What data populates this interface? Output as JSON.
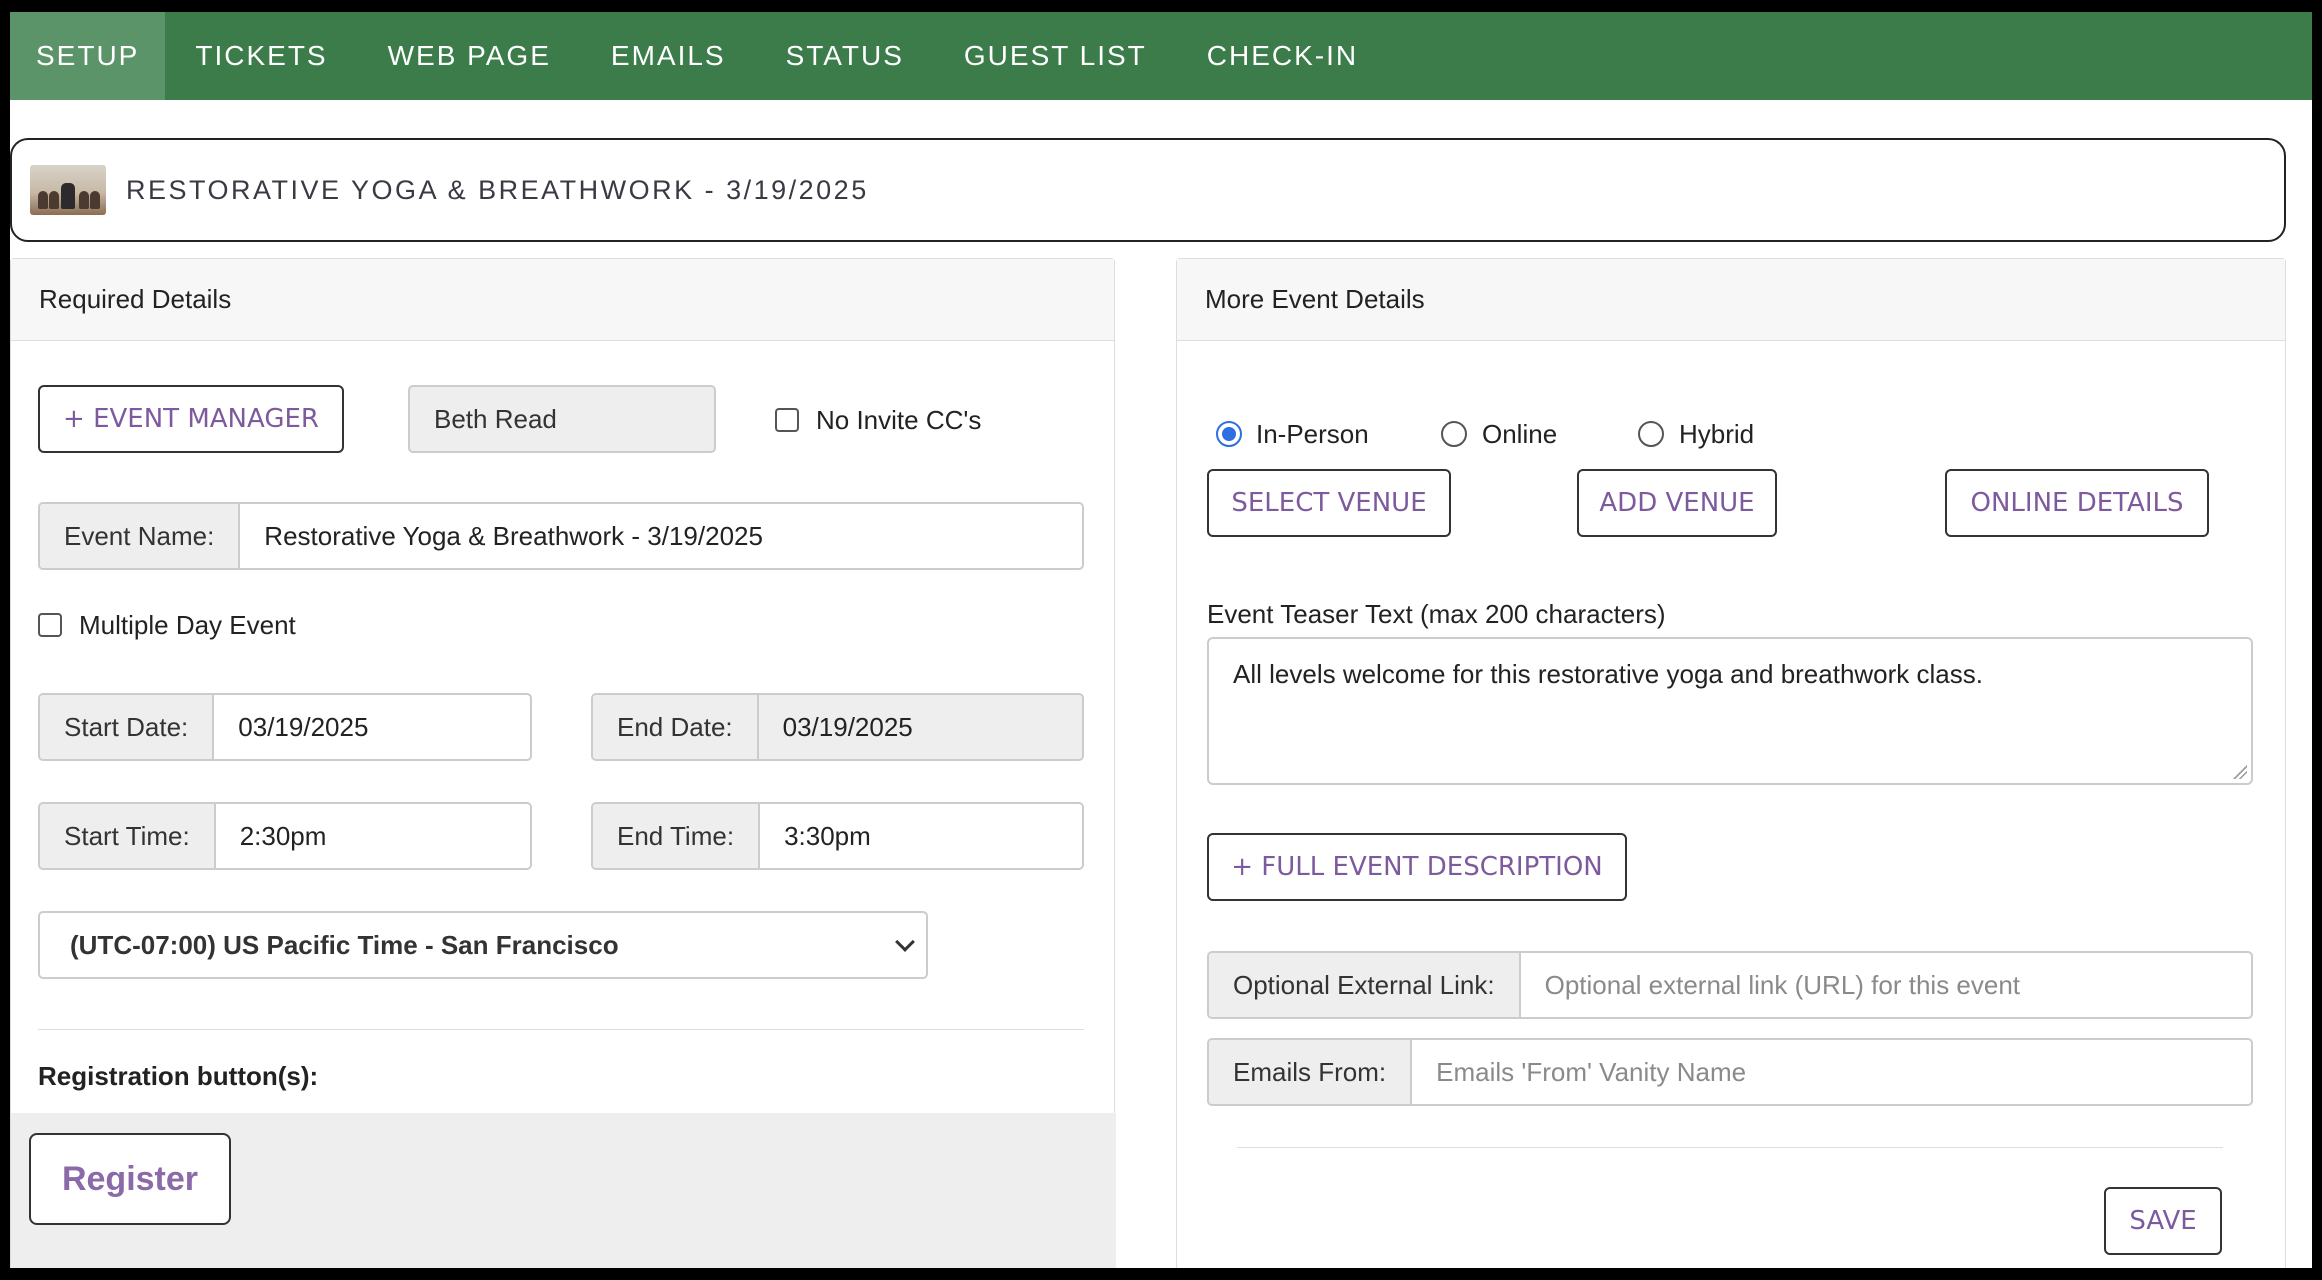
{
  "nav": {
    "tabs": [
      {
        "label": "SETUP"
      },
      {
        "label": "TICKETS"
      },
      {
        "label": "WEB PAGE"
      },
      {
        "label": "EMAILS"
      },
      {
        "label": "STATUS"
      },
      {
        "label": "GUEST LIST"
      },
      {
        "label": "CHECK-IN"
      }
    ],
    "active": "SETUP",
    "color": "#3b7c4a"
  },
  "event": {
    "title": "RESTORATIVE YOGA & BREATHWORK - 3/19/2025"
  },
  "required": {
    "heading": "Required Details",
    "event_manager_label": "+ EVENT MANAGER",
    "manager_name": "Beth Read",
    "no_invite_cc_label": "No Invite CC's",
    "event_name_label": "Event Name:",
    "event_name_value": "Restorative Yoga & Breathwork - 3/19/2025",
    "multiple_day_label": "Multiple Day Event",
    "start_date_label": "Start Date:",
    "start_date_value": "03/19/2025",
    "end_date_label": "End Date:",
    "end_date_value": "03/19/2025",
    "start_time_label": "Start Time:",
    "start_time_value": "2:30pm",
    "end_time_label": "End Time:",
    "end_time_value": "3:30pm",
    "timezone_value": "(UTC-07:00) US Pacific Time - San Francisco",
    "registration_label": "Registration button(s):",
    "register_button": "Register"
  },
  "more": {
    "heading": "More Event Details",
    "radio_options": [
      {
        "label": "In-Person",
        "checked": true
      },
      {
        "label": "Online",
        "checked": false
      },
      {
        "label": "Hybrid",
        "checked": false
      }
    ],
    "select_venue_label": "SELECT VENUE",
    "add_venue_label": "ADD VENUE",
    "online_details_label": "ONLINE DETAILS",
    "teaser_label": "Event Teaser Text (max 200 characters)",
    "teaser_value": "All levels welcome for this restorative yoga and breathwork class.",
    "full_description_label": "+ FULL EVENT DESCRIPTION",
    "external_link_label": "Optional External Link:",
    "external_link_placeholder": "Optional external link (URL) for this event",
    "emails_from_label": "Emails From:",
    "emails_from_placeholder": "Emails 'From' Vanity Name",
    "save_label": "SAVE"
  },
  "colors": {
    "accent_text": "#7d5a9e",
    "radio_selected": "#2d6fe0"
  }
}
